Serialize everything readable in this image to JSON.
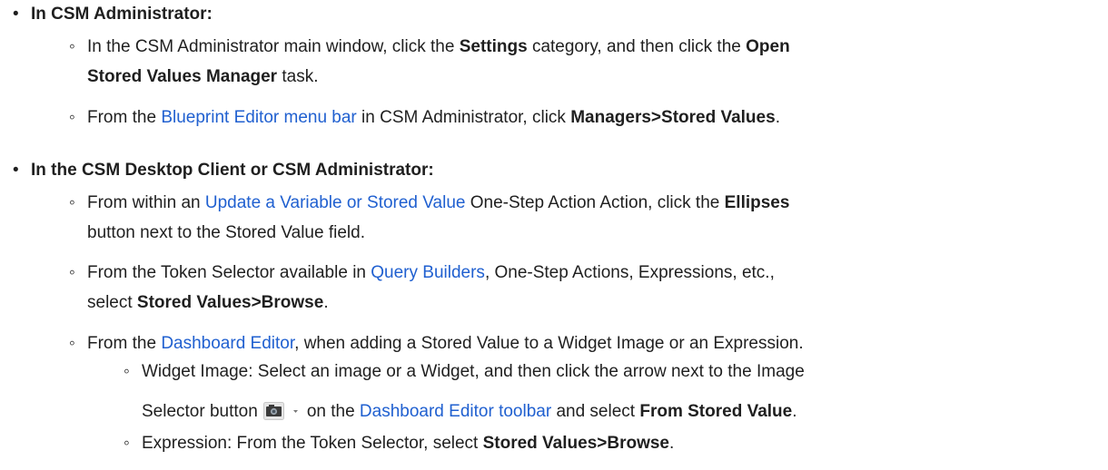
{
  "section1": {
    "bullet": "•",
    "heading": "In CSM Administrator:",
    "item1": {
      "bullet": "◦",
      "t1": "In the CSM Administrator main window, click the ",
      "b1": "Settings",
      "t2": " category, and then click the ",
      "b2a": "Open",
      "b2b": "Stored Values Manager",
      "t3": " task."
    },
    "item2": {
      "bullet": "◦",
      "t1": "From the ",
      "link1": "Blueprint Editor menu bar",
      "t2": " in CSM Administrator, click ",
      "b1": "Managers>Stored Values",
      "t3": "."
    }
  },
  "section2": {
    "bullet": "•",
    "heading": "In the CSM Desktop Client or CSM Administrator:",
    "item1": {
      "bullet": "◦",
      "t1": "From within an ",
      "link1": "Update a Variable or Stored Value",
      "t2": " One-Step Action Action, click the ",
      "b1": "Ellipses",
      "t3": "button next to the Stored Value field."
    },
    "item2": {
      "bullet": "◦",
      "t1": "From the Token Selector available in ",
      "link1": "Query Builders",
      "t2": ", One-Step Actions, Expressions, etc.,",
      "t3": "select ",
      "b1": "Stored Values>Browse",
      "t4": "."
    },
    "item3": {
      "bullet": "◦",
      "t1": "From the ",
      "link1": "Dashboard Editor",
      "t2": ", when adding a Stored Value to a Widget Image or an Expression.",
      "sub1": {
        "bullet": "◦",
        "t1": "Widget Image: Select an image or a Widget, and then click the arrow next to the Image",
        "t2": "Selector button",
        "icon": "camera-dropdown-icon",
        "t3": "on the ",
        "link1": "Dashboard Editor toolbar",
        "t4": " and select ",
        "b1": "From Stored Value",
        "t5": "."
      },
      "sub2": {
        "bullet": "◦",
        "t1": "Expression: From the Token Selector, select ",
        "b1": "Stored Values>Browse",
        "t2": "."
      }
    }
  }
}
